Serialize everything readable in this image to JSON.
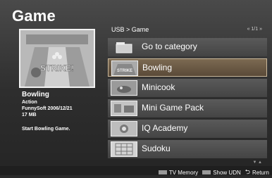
{
  "left": {
    "title": "Game",
    "selected": {
      "name": "Bowling",
      "genre": "Action",
      "publisher_date": "FunnySoft 2006/12/21",
      "size": "17 MB",
      "description": "Start Bowling Game."
    }
  },
  "right": {
    "breadcrumb": "USB > Game",
    "pager": "« 1/1 »",
    "items": [
      {
        "label": "Go to category",
        "icon": "folder-icon"
      },
      {
        "label": "Bowling",
        "icon": "bowling-thumb-icon"
      },
      {
        "label": "Minicook",
        "icon": "minicook-thumb-icon"
      },
      {
        "label": "Mini Game Pack",
        "icon": "minigame-thumb-icon"
      },
      {
        "label": "IQ Academy",
        "icon": "iqacademy-thumb-icon"
      },
      {
        "label": "Sudoku",
        "icon": "sudoku-thumb-icon"
      }
    ],
    "selected_index": 1,
    "scroll_hint": "▼ ▲"
  },
  "bottom": {
    "tv_memory": "TV Memory",
    "show_udn": "Show UDN",
    "return": "Return"
  }
}
